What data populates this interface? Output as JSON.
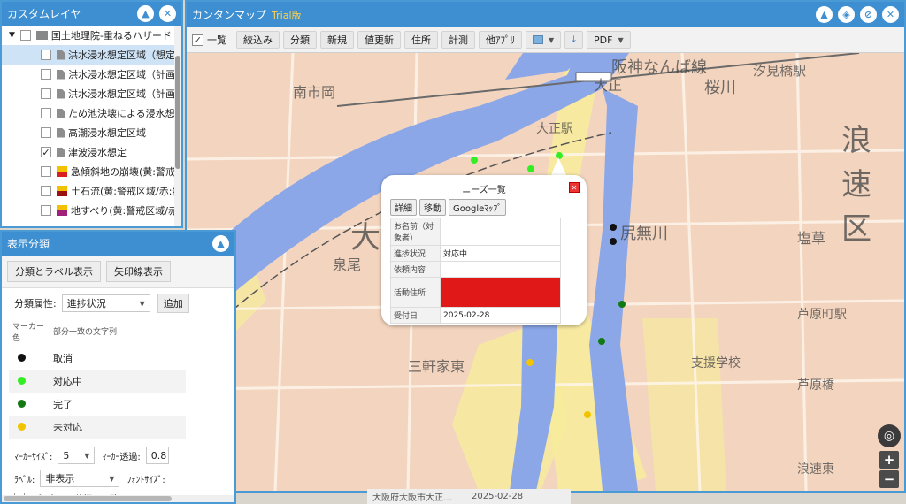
{
  "layer_panel": {
    "title": "カスタムレイヤ",
    "root_label": "国土地理院-重ねるハザード",
    "items": [
      {
        "label": "洪水浸水想定区域（想定最",
        "checked": false,
        "type": "doc"
      },
      {
        "label": "洪水浸水想定区域（計画規",
        "checked": false,
        "type": "doc"
      },
      {
        "label": "洪水浸水想定区域（計画規",
        "checked": false,
        "type": "doc"
      },
      {
        "label": "ため池決壊による浸水想定",
        "checked": false,
        "type": "doc"
      },
      {
        "label": "高潮浸水想定区域",
        "checked": false,
        "type": "doc"
      },
      {
        "label": "津波浸水想定",
        "checked": true,
        "type": "doc"
      },
      {
        "label": "急傾斜地の崩壊(黄:警戒区",
        "checked": false,
        "type": "swatch",
        "colors": [
          "#f2c200",
          "#d81e1e"
        ]
      },
      {
        "label": "土石流(黄:警戒区域/赤:特別",
        "checked": false,
        "type": "swatch",
        "colors": [
          "#f2c200",
          "#9b1010"
        ]
      },
      {
        "label": "地すべり(黄:警戒区域/赤:特",
        "checked": false,
        "type": "swatch",
        "colors": [
          "#f2c200",
          "#a0207a"
        ]
      }
    ]
  },
  "class_panel": {
    "title": "表示分類",
    "buttons": {
      "label_display": "分類とラベル表示",
      "arrow_display": "矢印線表示"
    },
    "attr_label": "分類属性:",
    "attr_value": "進捗状況",
    "add_label": "追加",
    "col_marker": "マーカー色",
    "col_text": "部分一致の文字列",
    "rows": [
      {
        "color": "#111111",
        "text": "取消"
      },
      {
        "color": "#33ee22",
        "text": "対応中"
      },
      {
        "color": "#137a13",
        "text": "完了"
      },
      {
        "color": "#f2c400",
        "text": "未対応"
      }
    ],
    "marker_size_label": "ﾏｰｶｰｻｲｽﾞ:",
    "marker_size_value": "5",
    "marker_alpha_label": "ﾏｰｶｰ透過:",
    "marker_alpha_value": "0.8",
    "label_label": "ﾗﾍﾞﾙ:",
    "label_value": "非表示",
    "font_size_label": "ﾌｫﾝﾄｻｲｽﾞ:",
    "label_only_match": "ﾗﾍﾞﾙ表示は分類に一致のみ"
  },
  "map_window": {
    "title": "カンタンマップ",
    "trial": "Trial版",
    "toolbar": {
      "list": "一覧",
      "filter": "絞込み",
      "classify": "分類",
      "new": "新規",
      "update": "値更新",
      "address": "住所",
      "measure": "計測",
      "other_apps": "他ｱﾌﾟﾘ",
      "pdf": "PDF"
    }
  },
  "popup": {
    "title": "ニーズ一覧",
    "buttons": {
      "detail": "詳細",
      "move": "移動",
      "google": "Googleﾏｯﾌﾟ"
    },
    "fields": {
      "name_label": "お名前（対象者）",
      "name_value": "",
      "progress_label": "進捗状況",
      "progress_value": "対応中",
      "request_label": "依頼内容",
      "request_value": "",
      "address_label": "活動住所",
      "date_label": "受付日",
      "date_value": "2025-02-28"
    }
  },
  "background_row": {
    "text": "大阪府大阪市大正…",
    "date": "2025-02-28"
  },
  "map_labels": [
    "南市岡",
    "大正",
    "阪神なんば線",
    "桜川",
    "汐見橋駅",
    "浪",
    "速",
    "区",
    "塩草",
    "大",
    "泉尾",
    "三軒家東",
    "芦原町駅",
    "支援学校",
    "芦原橋",
    "大正駅",
    "浪速東",
    "尻無川"
  ]
}
